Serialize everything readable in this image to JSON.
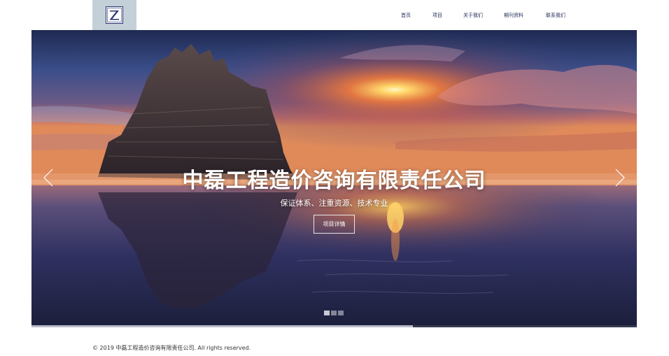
{
  "header": {
    "nav": [
      {
        "label": "首页"
      },
      {
        "label": "项目"
      },
      {
        "label": "关于我们"
      },
      {
        "label": "期刊资料"
      },
      {
        "label": "联系我们"
      }
    ]
  },
  "hero": {
    "title": "中磊工程造价咨询有限责任公司",
    "subtitle": "保证体系、注重资源、技术专业",
    "button_label": "项目详情",
    "slide_count": 3,
    "active_slide": 1,
    "progress": 0.63
  },
  "footer": {
    "copyright": "© 2019 中磊工程造价咨询有限责任公司. All rights reserved."
  },
  "colors": {
    "nav_text": "#1c2a55",
    "logo_bg": "#c4d0d8",
    "logo_mark": "#2b3572"
  }
}
